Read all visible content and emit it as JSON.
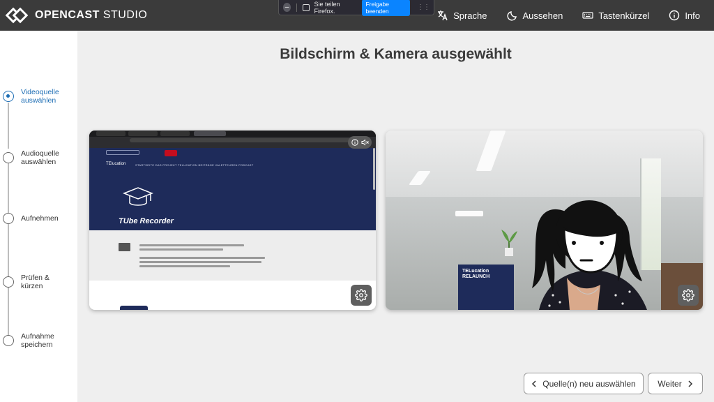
{
  "app": {
    "logo_bold": "OPENCAST",
    "logo_light": "STUDIO"
  },
  "header": {
    "nav": [
      {
        "label": "Sprache",
        "icon": "translate-icon"
      },
      {
        "label": "Aussehen",
        "icon": "moon-icon"
      },
      {
        "label": "Tastenkürzel",
        "icon": "keyboard-icon"
      },
      {
        "label": "Info",
        "icon": "info-icon"
      }
    ]
  },
  "sharebar": {
    "text": "Sie teilen Firefox.",
    "stop_label": "Freigabe beenden"
  },
  "steps": [
    {
      "label": "Videoquelle auswählen",
      "active": true
    },
    {
      "label": "Audioquelle auswählen",
      "active": false
    },
    {
      "label": "Aufnehmen",
      "active": false
    },
    {
      "label": "Prüfen & kürzen",
      "active": false
    },
    {
      "label": "Aufnahme speichern",
      "active": false
    }
  ],
  "main": {
    "title": "Bildschirm & Kamera ausgewählt"
  },
  "screen_preview": {
    "site_brand": "TElucation",
    "site_menu": "STARTSEITE   DAS PROJEKT TELUCATION   BEITRÄGE   VALETTEUREN   PODCAST",
    "site_title": "TUbe Recorder"
  },
  "camera_preview": {
    "banner_text": "TELucation RELAUNCH"
  },
  "footer": {
    "back_label": "Quelle(n) neu auswählen",
    "next_label": "Weiter"
  },
  "colors": {
    "header_bg": "#3b3b3b",
    "accent": "#1f6fb5",
    "share_button": "#0a84ff"
  }
}
